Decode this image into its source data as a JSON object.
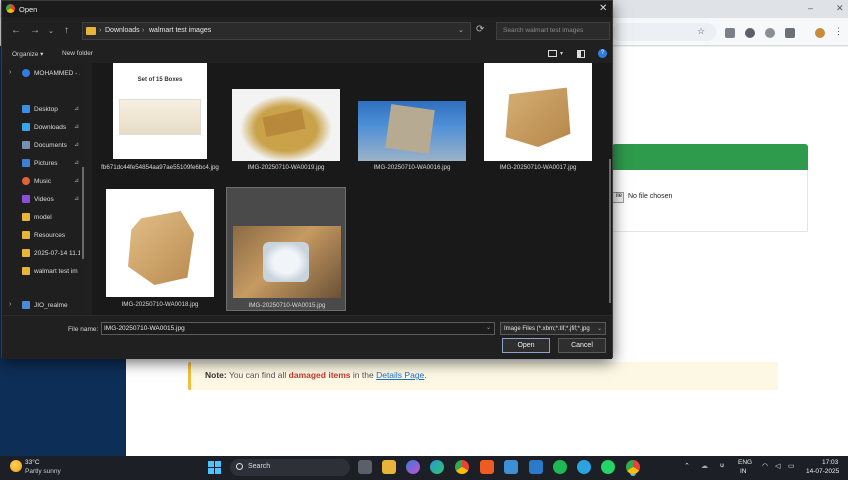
{
  "dialog": {
    "title": "Open",
    "address": {
      "segments": [
        "Downloads",
        "walmart test images"
      ],
      "separator": "›"
    },
    "search_placeholder": "Search walmart test images",
    "toolbar": {
      "organize": "Organize ▾",
      "new_folder": "New folder"
    },
    "nav": [
      {
        "label": "MOHAMMED - ...",
        "icon": "cloud-icon",
        "color": "#2f7de1",
        "expand": "›"
      },
      {
        "label": "Desktop",
        "icon": "desktop-icon",
        "color": "#3a8ee6",
        "pin": "📌"
      },
      {
        "label": "Downloads",
        "icon": "download-icon",
        "color": "#3aa4e6",
        "pin": "📌"
      },
      {
        "label": "Documents",
        "icon": "document-icon",
        "color": "#7a8fb0",
        "pin": "📌"
      },
      {
        "label": "Pictures",
        "icon": "pictures-icon",
        "color": "#3d7fd6",
        "pin": "📌"
      },
      {
        "label": "Music",
        "icon": "music-icon",
        "color": "#e0623a",
        "pin": "📌"
      },
      {
        "label": "Videos",
        "icon": "videos-icon",
        "color": "#8a4fd6",
        "pin": "📌"
      },
      {
        "label": "model",
        "icon": "folder-icon",
        "color": "#e8b43a"
      },
      {
        "label": "Resources",
        "icon": "folder-icon",
        "color": "#e8b43a"
      },
      {
        "label": "2025-07-14 11.1",
        "icon": "folder-icon",
        "color": "#e8b43a"
      },
      {
        "label": "walmart test im",
        "icon": "folder-icon",
        "color": "#e8b43a"
      },
      {
        "label": "JIO_realme",
        "icon": "phone-icon",
        "color": "#4a8ad6",
        "expand": "›"
      }
    ],
    "files": [
      {
        "name": "fb671dc44fe54854aa97ae55109fe6bc4.jpg",
        "thumb_text": "Set of 15 Boxes",
        "selected": false
      },
      {
        "name": "IMG-20250710-WA0019.jpg",
        "selected": false
      },
      {
        "name": "IMG-20250710-WA0016.jpg",
        "selected": false
      },
      {
        "name": "IMG-20250710-WA0017.jpg",
        "selected": false
      },
      {
        "name": "IMG-20250710-WA0018.jpg",
        "selected": false
      },
      {
        "name": "IMG-20250710-WA0015.jpg",
        "selected": true
      }
    ],
    "file_name_label": "File name:",
    "file_name_value": "IMG-20250710-WA0015.jpg",
    "file_type": "Image Files (*.xbm;*.tif;*.jfif;*.jpg",
    "open_label": "Open",
    "cancel_label": "Cancel",
    "close_glyph": "✕"
  },
  "page": {
    "no_file": "No file chosen",
    "file_btn": "ile",
    "note": {
      "prefix": "Note:",
      "text1": " You can find all ",
      "highlight": "damaged items",
      "text2": " in the ",
      "link": "Details Page",
      "end": "."
    }
  },
  "taskbar": {
    "temp": "33°C",
    "weather": "Partly sunny",
    "search": "Search",
    "lang1": "ENG",
    "lang2": "IN",
    "time": "17:03",
    "date": "14-07-2025"
  },
  "colors": {
    "accent_green": "#2e9a4c",
    "selection": "#4a4a4a",
    "dialog_bg": "#202020"
  }
}
